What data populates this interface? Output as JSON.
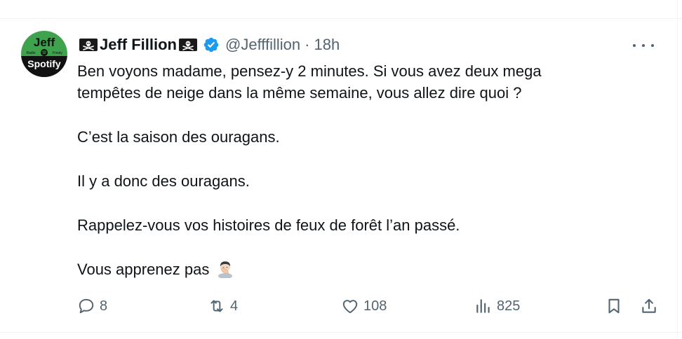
{
  "author": {
    "display_name": "Jeff Fillion",
    "handle": "@Jefffillion",
    "separator": "·",
    "time": "18h",
    "avatar": {
      "top_text": "Jeff",
      "bottom_text": "Spotify",
      "badge_left": "Radio",
      "badge_right": "Fmaty",
      "bg_color": "#3fa34d",
      "bottom_color": "#111111"
    }
  },
  "tweet": {
    "lines": [
      "Ben voyons madame, pensez-y  2 minutes. Si vous avez deux mega",
      "tempêtes de neige dans la même semaine, vous allez dire quoi ?",
      "C’est la saison des ouragans.",
      "Il y a donc des ouragans.",
      "Rappelez-vous vos histoires de feux de forêt l’an passé.",
      "Vous apprenez pas"
    ],
    "emoji": "facepalm-emoji"
  },
  "actions": {
    "replies": "8",
    "retweets": "4",
    "likes": "108",
    "views": "825"
  },
  "colors": {
    "verified": "#1d9bf0",
    "muted": "#536471",
    "text": "#0f1419"
  }
}
